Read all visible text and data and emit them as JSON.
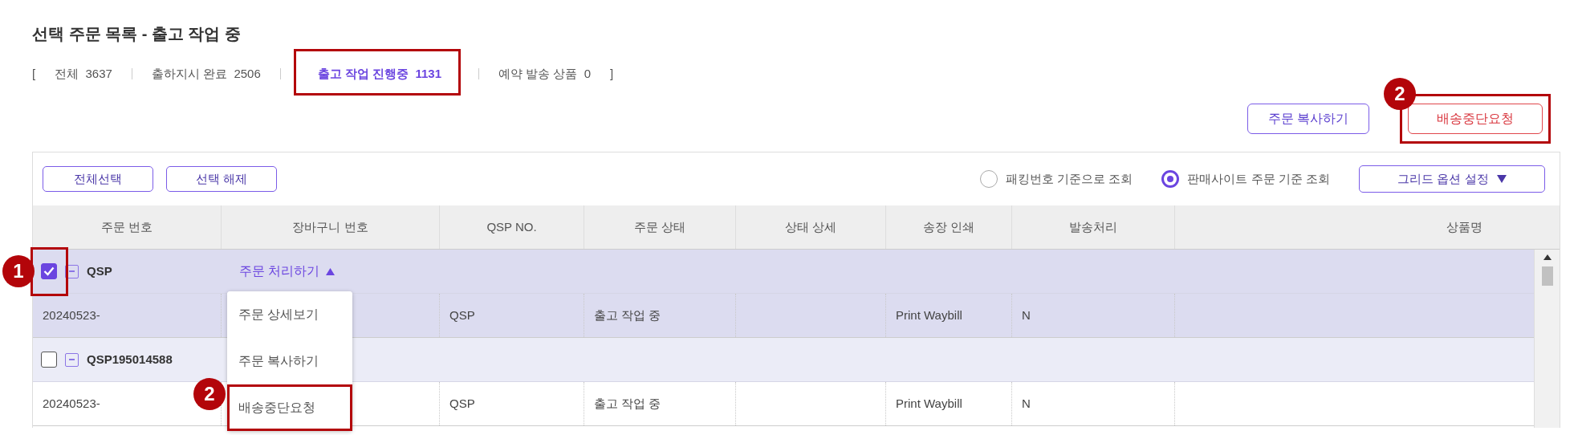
{
  "title": "선택 주문 목록 - 출고 작업 중",
  "stats": {
    "open": "[",
    "close": "]",
    "items": [
      {
        "label": "전체",
        "count": "3637",
        "selected": false,
        "highlighted": false
      },
      {
        "label": "출하지시 완료",
        "count": "2506",
        "selected": false,
        "highlighted": false
      },
      {
        "label": "출고 작업 진행중",
        "count": "1131",
        "selected": true,
        "highlighted": true
      },
      {
        "label": "예약 발송 상품",
        "count": "0",
        "selected": false,
        "highlighted": false
      }
    ]
  },
  "actions": [
    {
      "label": "주문 복사하기",
      "kind": "primary",
      "highlighted": false
    },
    {
      "label": "배송중단요청",
      "kind": "danger",
      "highlighted": true,
      "annotation": "2"
    }
  ],
  "toolbar": {
    "buttons": [
      "전체선택",
      "선택 해제"
    ],
    "view_options": [
      {
        "label": "패킹번호 기준으로 조회",
        "selected": false
      },
      {
        "label": "판매사이트 주문 기준 조회",
        "selected": true
      }
    ],
    "grid_options": "그리드 옵션 설정"
  },
  "table": {
    "columns": [
      "주문 번호",
      "장바구니 번호",
      "QSP NO.",
      "주문 상태",
      "상태 상세",
      "송장 인쇄",
      "발송처리",
      "상품명"
    ],
    "rows": [
      {
        "kind": "group",
        "checked": true,
        "highlighted": true,
        "annotation": "1",
        "order": "QSP",
        "action": {
          "label": "주문 처리하기",
          "expanded": true,
          "menu": [
            {
              "label": "주문 상세보기",
              "highlighted": false
            },
            {
              "label": "주문 복사하기",
              "highlighted": false
            },
            {
              "label": "배송중단요청",
              "highlighted": true,
              "annotation": "2"
            }
          ]
        }
      },
      {
        "kind": "item",
        "selected": true,
        "order_no": "20240523-",
        "qsp_no": "QSP",
        "status": "출고 작업 중",
        "waybill": "Print Waybill",
        "shipped": "N"
      },
      {
        "kind": "group",
        "checked": false,
        "highlighted": false,
        "order": "QSP195014588"
      },
      {
        "kind": "item",
        "selected": false,
        "order_no": "20240523-",
        "qsp_no": "QSP",
        "status": "출고 작업 중",
        "waybill": "Print Waybill",
        "shipped": "N"
      }
    ]
  }
}
